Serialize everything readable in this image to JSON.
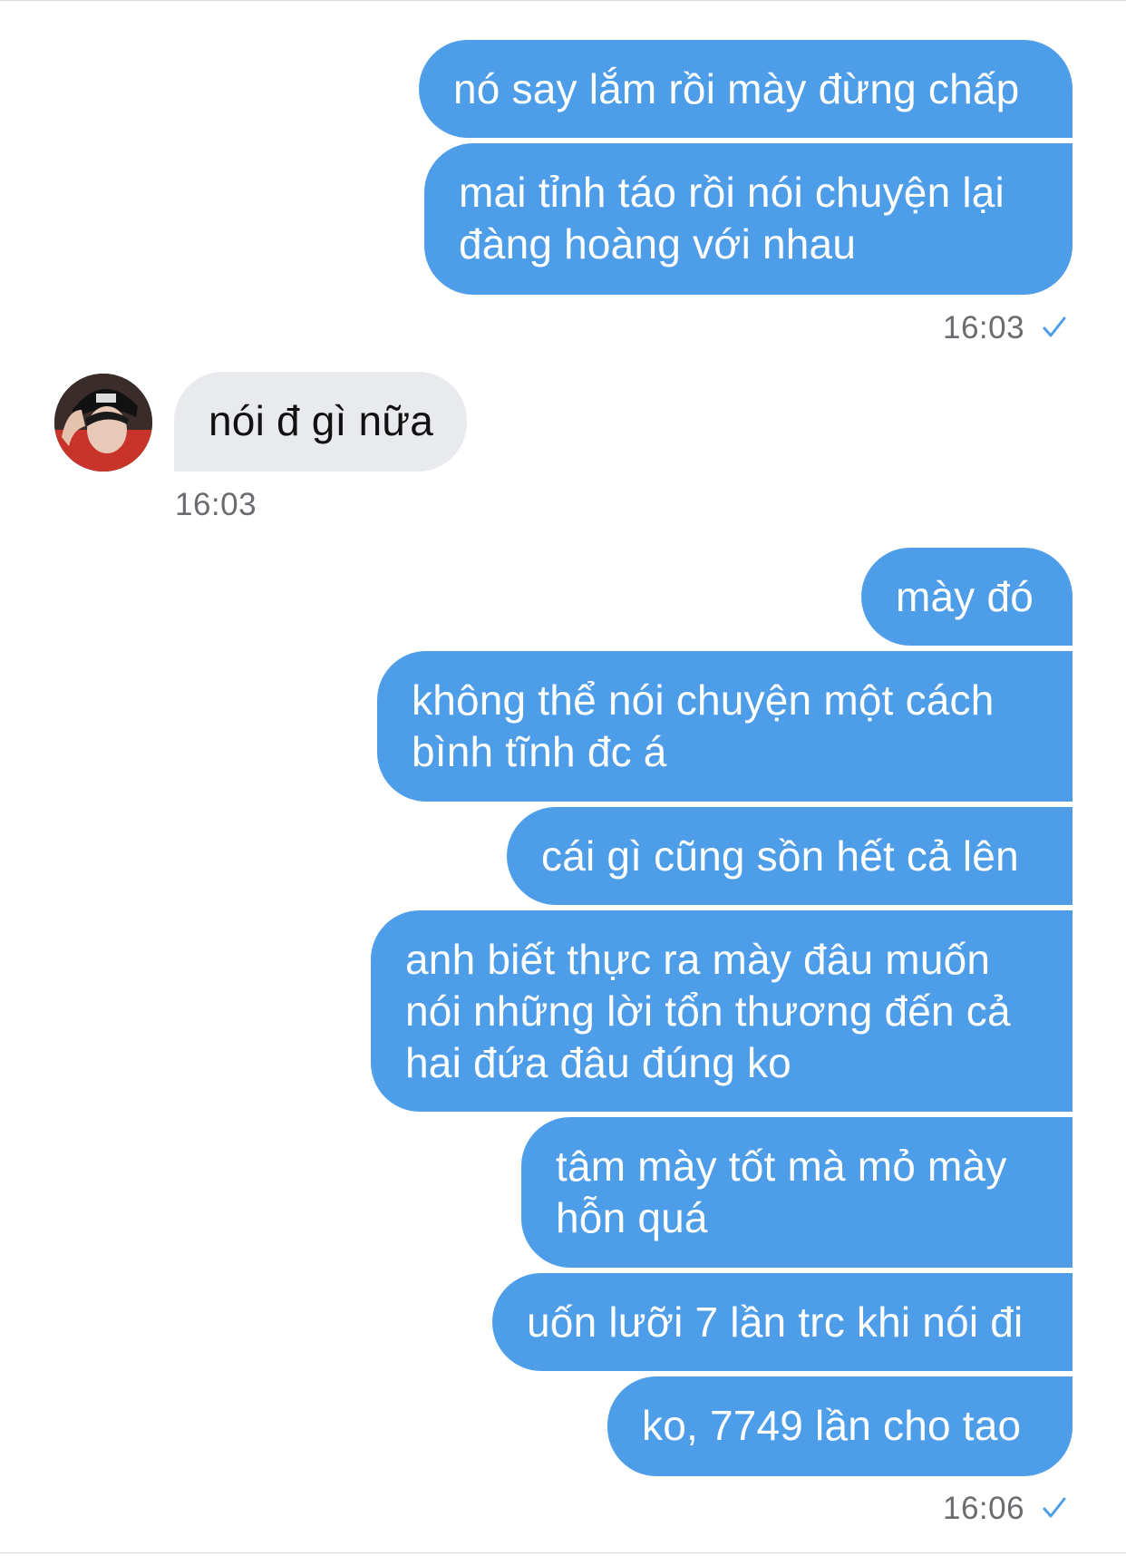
{
  "messages": {
    "group1": {
      "m1": "nó say lắm rồi mày đừng chấp",
      "m2_line1": "mai tỉnh táo rồi nói chuyện lại",
      "m2_line2": "đàng hoàng với nhau",
      "time": "16:03"
    },
    "incoming": {
      "m1": "nói đ gì nữa",
      "time": "16:03"
    },
    "group2": {
      "m1": "mày đó",
      "m2_line1": "không thể nói chuyện một cách",
      "m2_line2": "bình tĩnh đc á",
      "m3": "cái gì cũng sồn hết cả lên",
      "m4_line1": "anh biết thực ra mày đâu muốn",
      "m4_line2": "nói những lời tổn thương đến cả",
      "m4_line3": "hai đứa đâu đúng ko",
      "m5_line1": "tâm mày tốt mà mỏ mày",
      "m5_line2": "hỗn quá",
      "m6": "uốn lưỡi 7 lần trc khi nói đi",
      "m7": "ko, 7749 lần cho tao",
      "time": "16:06"
    }
  },
  "colors": {
    "outgoing_bubble": "#4e9de8",
    "incoming_bubble": "#e9eaee",
    "read_check": "#4e9de8",
    "timestamp": "#6b6b70"
  },
  "icons": {
    "read_check": "checkmark-icon",
    "avatar": "contact-avatar"
  }
}
